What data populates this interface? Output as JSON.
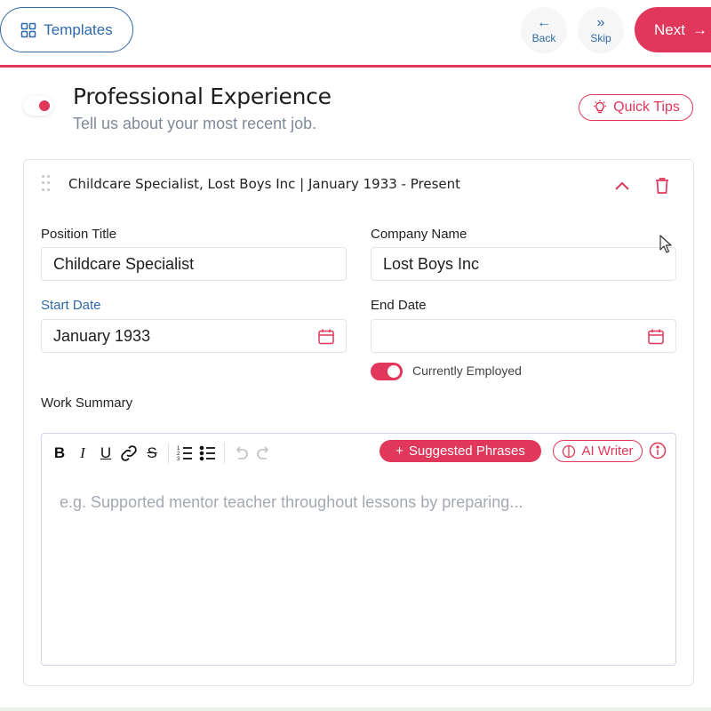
{
  "topbar": {
    "templates_label": "Templates",
    "back_label": "Back",
    "skip_label": "Skip",
    "next_label": "Next"
  },
  "section": {
    "title": "Professional Experience",
    "subtitle": "Tell us about your most recent job.",
    "quick_tips_label": "Quick Tips"
  },
  "entry": {
    "header": "Childcare Specialist, Lost Boys Inc | January 1933 - Present",
    "position_title_label": "Position Title",
    "position_title_value": "Childcare Specialist",
    "company_name_label": "Company Name",
    "company_name_value": "Lost Boys Inc",
    "start_date_label": "Start Date",
    "start_date_value": "January 1933",
    "end_date_label": "End Date",
    "end_date_value": "",
    "currently_employed_label": "Currently Employed",
    "currently_employed": true,
    "work_summary_label": "Work Summary"
  },
  "editor": {
    "suggested_label": "Suggested Phrases",
    "ai_writer_label": "AI Writer",
    "placeholder": "e.g. Supported mentor teacher throughout lessons by preparing...",
    "tools": [
      "B",
      "I",
      "U",
      "link",
      "S",
      "ordered-list",
      "bullet-list",
      "undo",
      "redo"
    ]
  },
  "colors": {
    "accent": "#e0375a",
    "brand_blue": "#2f6aa8"
  }
}
